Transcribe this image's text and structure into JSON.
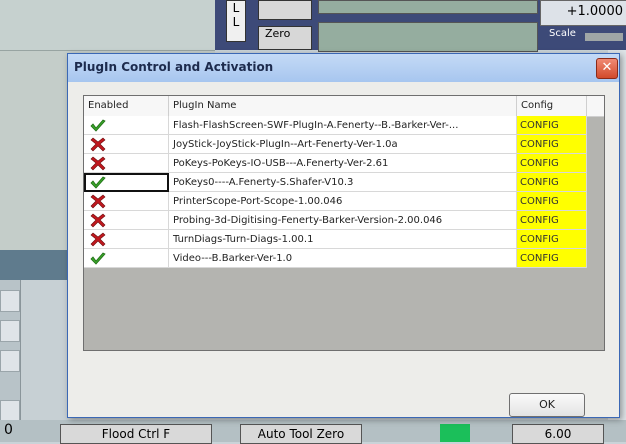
{
  "background": {
    "zero_label": "Zero",
    "scale_label": "Scale",
    "dro_right": "+1.0000",
    "bottom_left_num": "0",
    "flood_label": "Flood Ctrl F",
    "auto_tool_label": "Auto Tool Zero",
    "bottom_right_num": "6.00",
    "l_label_1": "L",
    "l_label_2": "L"
  },
  "dialog": {
    "title": "PlugIn Control and Activation",
    "close_symbol": "✕",
    "columns": {
      "enabled": "Enabled",
      "name": "PlugIn Name",
      "config": "Config"
    },
    "rows": [
      {
        "enabled": true,
        "name": "Flash-FlashScreen-SWF-PlugIn-A.Fenerty--B.-Barker-Ver-...",
        "config": "CONFIG"
      },
      {
        "enabled": false,
        "name": "JoyStick-JoyStick-PlugIn--Art-Fenerty-Ver-1.0a",
        "config": "CONFIG"
      },
      {
        "enabled": false,
        "name": "PoKeys-PoKeys-IO-USB---A.Fenerty-Ver-2.61",
        "config": "CONFIG"
      },
      {
        "enabled": true,
        "name": "PoKeys0----A.Fenerty-S.Shafer-V10.3",
        "config": "CONFIG"
      },
      {
        "enabled": false,
        "name": "PrinterScope-Port-Scope-1.00.046",
        "config": "CONFIG"
      },
      {
        "enabled": false,
        "name": "Probing-3d-Digitising-Fenerty-Barker-Version-2.00.046",
        "config": "CONFIG"
      },
      {
        "enabled": false,
        "name": "TurnDiags-Turn-Diags-1.00.1",
        "config": "CONFIG"
      },
      {
        "enabled": true,
        "name": "Video---B.Barker-Ver-1.0",
        "config": "CONFIG"
      }
    ],
    "ok_label": "OK"
  },
  "colors": {
    "config_cell": "#ffff00",
    "check_green": "#3aa32a",
    "x_red": "#c0181e",
    "title_text": "#1d2b4d"
  },
  "icons": {
    "enabled_true": "check-icon",
    "enabled_false": "x-icon"
  }
}
